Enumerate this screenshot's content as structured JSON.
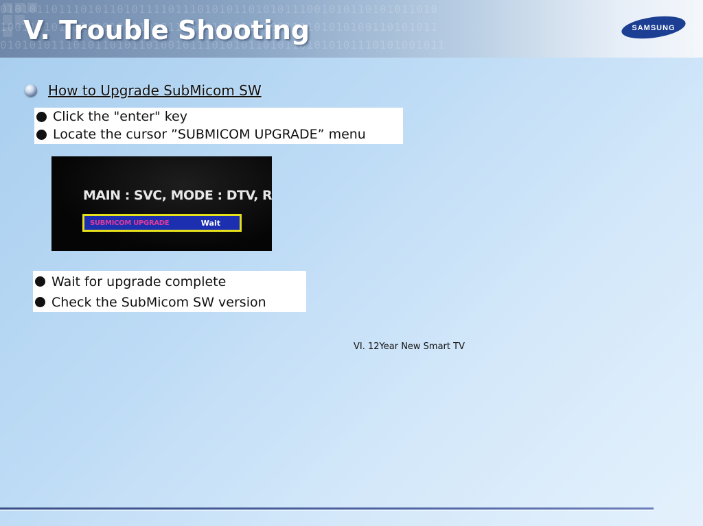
{
  "header": {
    "title": "V. Trouble Shooting",
    "binary_rows": [
      "010101101110101101011110111010101101010111001010110101011010",
      "100110101011010101110101101001010110100111101010100110101011",
      "0101010111010110101101001011101010110101101010101110101001011"
    ]
  },
  "logo": {
    "text": "SAMSUNG",
    "color": "#1c3f94"
  },
  "section": {
    "heading": "How to Upgrade SubMicom SW",
    "steps_top": [
      "Click the \"enter\" key",
      "Locate the cursor ”SUBMICOM UPGRADE” menu"
    ],
    "screen": {
      "main_line": "MAIN : SVC, MODE : DTV, RES",
      "menu_label": "SUBMICOM UPGRADE",
      "menu_value": "Wait",
      "colors": {
        "bar": "#1c2fb0",
        "border": "#e6e01c",
        "label": "#e03a9a"
      }
    },
    "steps_bottom": [
      "Wait for upgrade complete",
      "Check the SubMicom SW version"
    ]
  },
  "footer": {
    "text": "VI. 12Year New Smart TV"
  }
}
